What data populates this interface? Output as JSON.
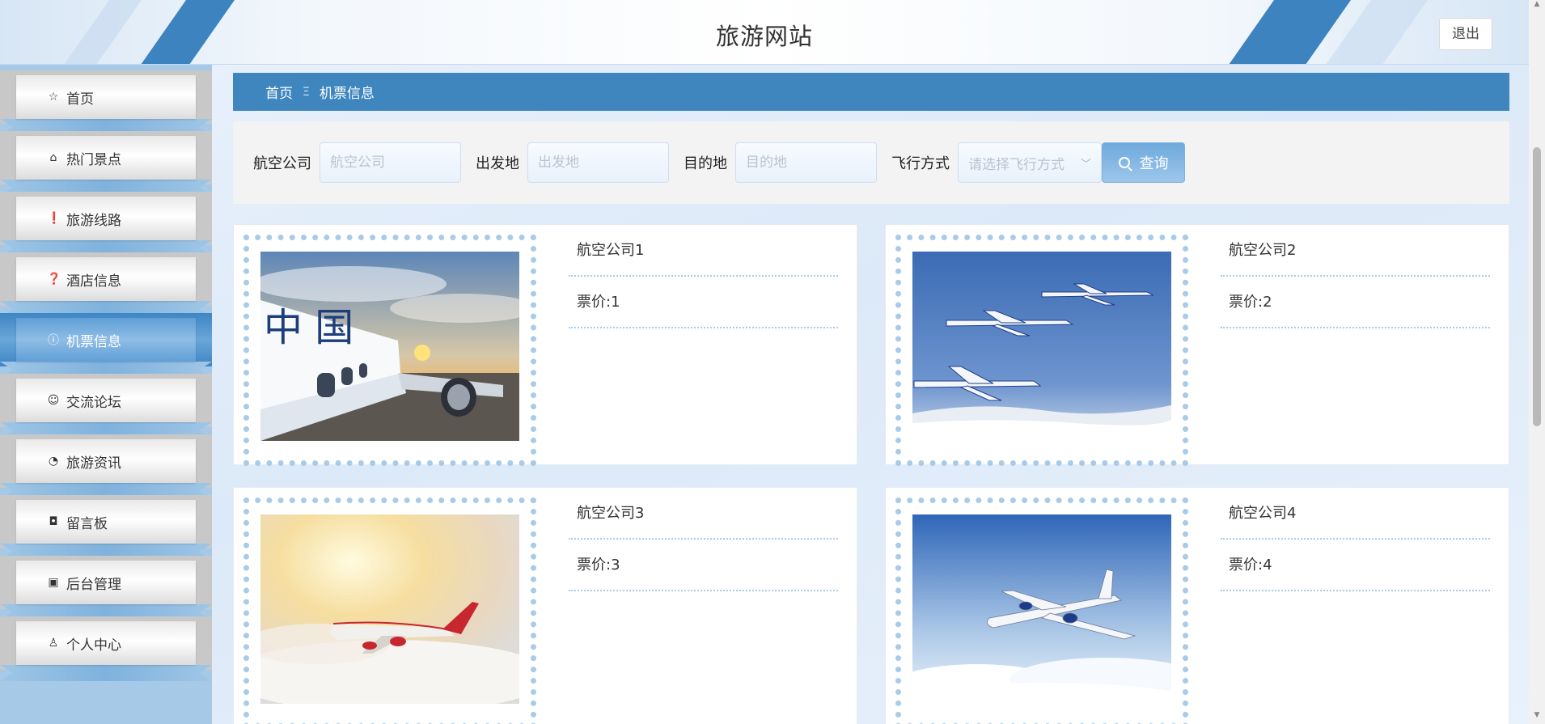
{
  "header": {
    "title": "旅游网站",
    "logout_label": "退出"
  },
  "sidebar": {
    "items": [
      {
        "label": "首页",
        "icon": "star-icon",
        "glyph": "☆",
        "active": false
      },
      {
        "label": "热门景点",
        "icon": "bag-icon",
        "glyph": "⌂",
        "active": false
      },
      {
        "label": "旅游线路",
        "icon": "warning-icon",
        "glyph": "❗",
        "active": false
      },
      {
        "label": "酒店信息",
        "icon": "question-icon",
        "glyph": "❓",
        "active": false
      },
      {
        "label": "机票信息",
        "icon": "info-icon",
        "glyph": "ⓘ",
        "active": true
      },
      {
        "label": "交流论坛",
        "icon": "smile-icon",
        "glyph": "☺",
        "active": false
      },
      {
        "label": "旅游资讯",
        "icon": "chart-icon",
        "glyph": "◔",
        "active": false
      },
      {
        "label": "留言板",
        "icon": "camera-icon",
        "glyph": "◘",
        "active": false
      },
      {
        "label": "后台管理",
        "icon": "box-icon",
        "glyph": "▣",
        "active": false
      },
      {
        "label": "个人中心",
        "icon": "user-icon",
        "glyph": "♙",
        "active": false
      }
    ]
  },
  "breadcrumb": {
    "home": "首页",
    "separator": "Ξ",
    "current": "机票信息"
  },
  "search": {
    "airline_label": "航空公司",
    "airline_placeholder": "航空公司",
    "origin_label": "出发地",
    "origin_placeholder": "出发地",
    "destination_label": "目的地",
    "destination_placeholder": "目的地",
    "flight_mode_label": "飞行方式",
    "flight_mode_placeholder": "请选择飞行方式",
    "query_label": "查询"
  },
  "cards": [
    {
      "airline": "航空公司1",
      "price_label": "票价:",
      "price": "1",
      "photo": "china-southern-plane-photo"
    },
    {
      "airline": "航空公司2",
      "price_label": "票价:",
      "price": "2",
      "photo": "three-jets-photo"
    },
    {
      "airline": "航空公司3",
      "price_label": "票价:",
      "price": "3",
      "photo": "sunset-plane-photo"
    },
    {
      "airline": "航空公司4",
      "price_label": "票价:",
      "price": "4",
      "photo": "plane-over-clouds-photo"
    }
  ]
}
